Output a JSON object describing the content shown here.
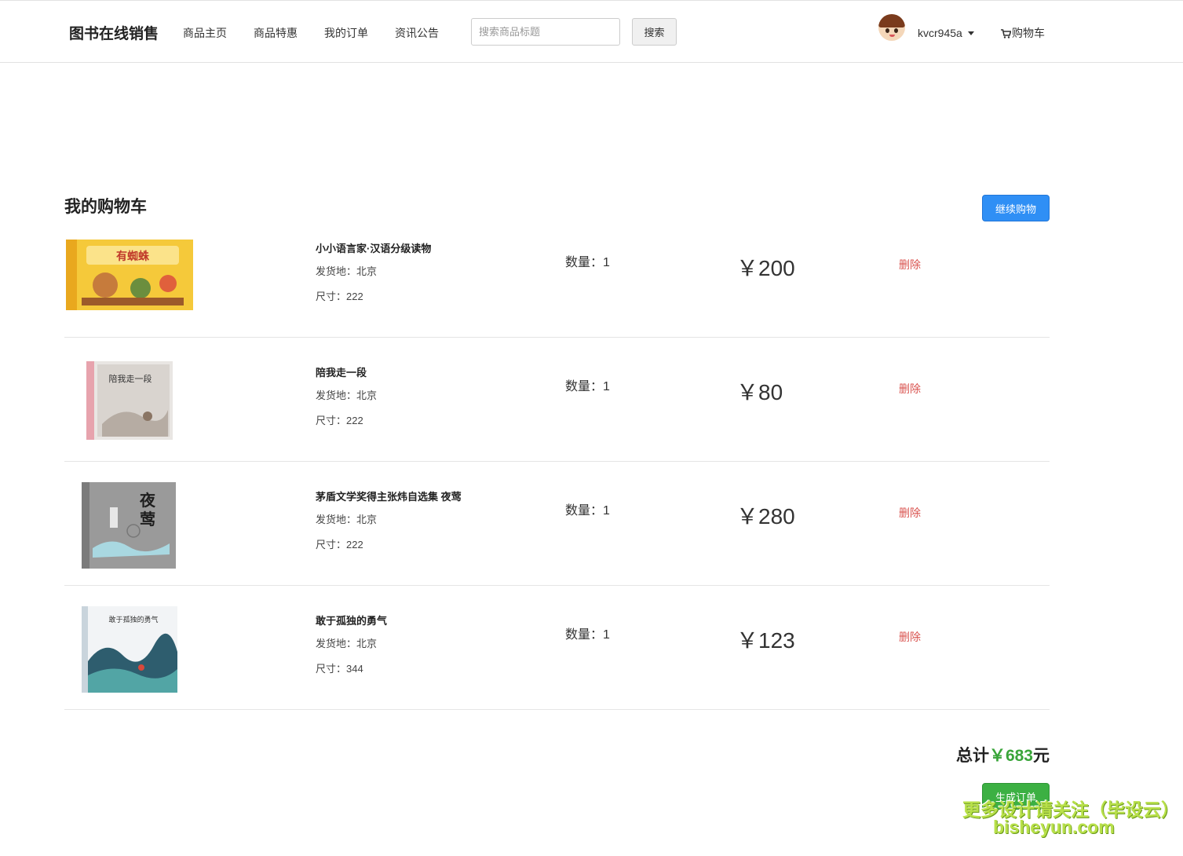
{
  "header": {
    "brand": "图书在线销售",
    "nav": [
      "商品主页",
      "商品特惠",
      "我的订单",
      "资讯公告"
    ],
    "search_placeholder": "搜索商品标题",
    "search_button": "搜索",
    "username": "kvcr945a",
    "cart_label": "购物车"
  },
  "cart": {
    "title": "我的购物车",
    "continue_button": "继续购物",
    "items": [
      {
        "name": "小小语言家·汉语分级读物",
        "origin": "发货地：北京",
        "size": "尺寸：222",
        "qty": "数量：1",
        "price": "￥200",
        "delete": "删除"
      },
      {
        "name": "陪我走一段",
        "origin": "发货地：北京",
        "size": "尺寸：222",
        "qty": "数量：1",
        "price": "￥80",
        "delete": "删除"
      },
      {
        "name": "茅盾文学奖得主张炜自选集 夜莺",
        "origin": "发货地：北京",
        "size": "尺寸：222",
        "qty": "数量：1",
        "price": "￥280",
        "delete": "删除"
      },
      {
        "name": "敢于孤独的勇气",
        "origin": "发货地：北京",
        "size": "尺寸：344",
        "qty": "数量：1",
        "price": "￥123",
        "delete": "删除"
      }
    ],
    "total_prefix": "总计",
    "total_amount": "￥683",
    "total_suffix": "元",
    "order_button": "生成订单"
  },
  "watermark": {
    "line1": "更多设计请关注（毕设云）",
    "line2": "bisheyun.com"
  },
  "colors": {
    "primary": "#2f8ff5",
    "success": "#3cb043",
    "danger": "#d9534f"
  }
}
